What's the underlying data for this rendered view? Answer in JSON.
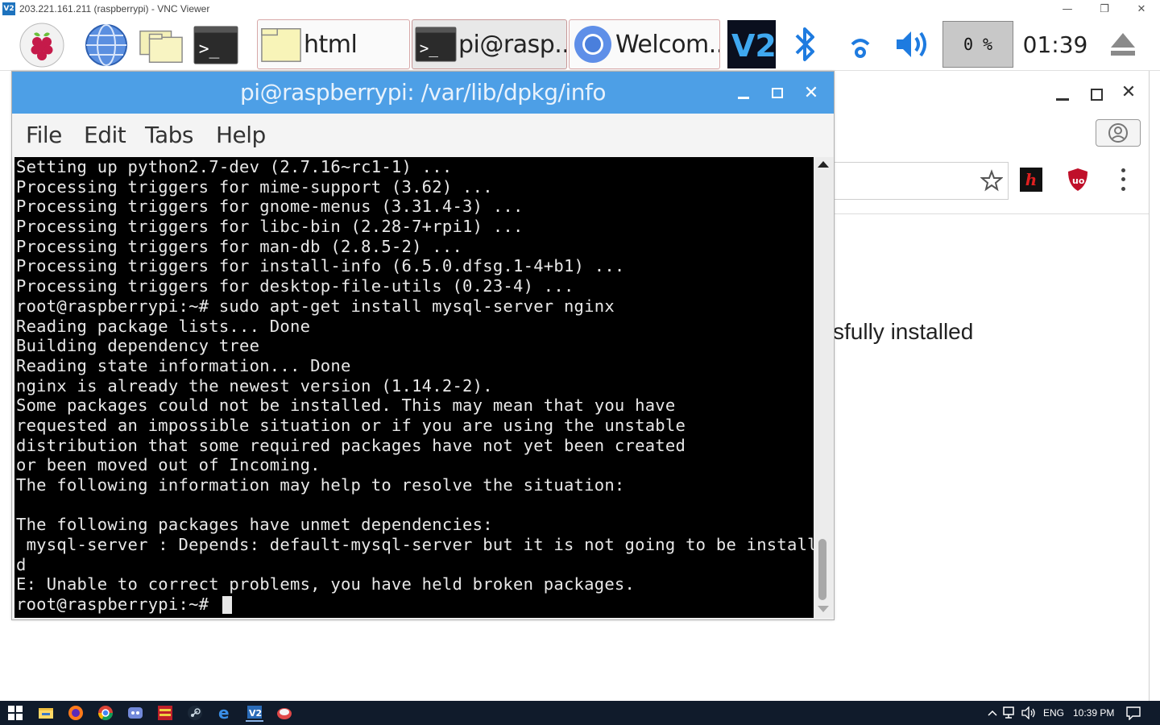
{
  "vnc": {
    "logo_text": "V2",
    "title": "203.221.161.211 (raspberrypi) - VNC Viewer",
    "minimize": "—",
    "restore": "❐",
    "close": "✕"
  },
  "pi_panel": {
    "tasks": [
      {
        "label": "html",
        "icon": "folder-icon"
      },
      {
        "label": "pi@rasp...",
        "icon": "terminal-icon"
      },
      {
        "label": "Welcom...",
        "icon": "chromium-icon"
      }
    ],
    "cpu_usage": "0 %",
    "clock": "01:39"
  },
  "terminal": {
    "title": "pi@raspberrypi: /var/lib/dpkg/info",
    "menu": [
      "File",
      "Edit",
      "Tabs",
      "Help"
    ],
    "lines": [
      "Setting up python2.7-dev (2.7.16~rc1-1) ...",
      "Processing triggers for mime-support (3.62) ...",
      "Processing triggers for gnome-menus (3.31.4-3) ...",
      "Processing triggers for libc-bin (2.28-7+rpi1) ...",
      "Processing triggers for man-db (2.8.5-2) ...",
      "Processing triggers for install-info (6.5.0.dfsg.1-4+b1) ...",
      "Processing triggers for desktop-file-utils (0.23-4) ...",
      "root@raspberrypi:~# sudo apt-get install mysql-server nginx",
      "Reading package lists... Done",
      "Building dependency tree",
      "Reading state information... Done",
      "nginx is already the newest version (1.14.2-2).",
      "Some packages could not be installed. This may mean that you have",
      "requested an impossible situation or if you are using the unstable",
      "distribution that some required packages have not yet been created",
      "or been moved out of Incoming.",
      "The following information may help to resolve the situation:",
      "",
      "The following packages have unmet dependencies:",
      " mysql-server : Depends: default-mysql-server but it is not going to be installe",
      "d",
      "E: Unable to correct problems, you have held broken packages."
    ],
    "prompt": "root@raspberrypi:~# "
  },
  "browser": {
    "page_text": "sfully installed"
  },
  "win_taskbar": {
    "language": "ENG",
    "time": "10:39 PM"
  },
  "colors": {
    "terminal_titlebar": "#4d9fe6",
    "terminal_bg": "#000000",
    "terminal_fg": "#e8e8e8",
    "win_taskbar": "#101b2b"
  }
}
